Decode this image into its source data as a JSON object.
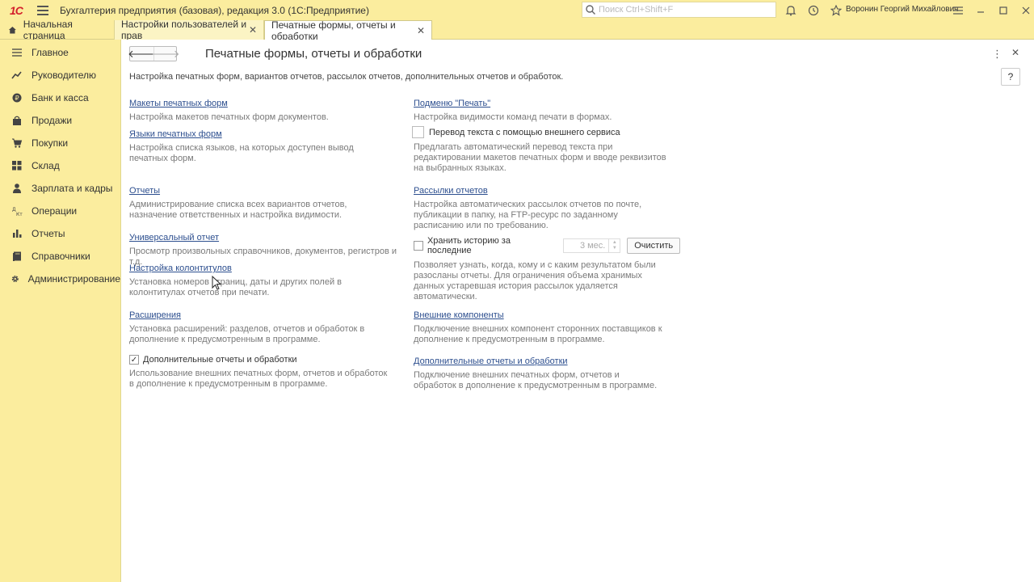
{
  "app": {
    "logo": "1С",
    "title": "Бухгалтерия предприятия (базовая), редакция 3.0  (1С:Предприятие)",
    "search_placeholder": "Поиск Ctrl+Shift+F",
    "user": "Воронин Георгий Михайлович"
  },
  "tabs": [
    {
      "label": "Начальная страница"
    },
    {
      "label": "Настройки пользователей и прав"
    },
    {
      "label": "Печатные формы, отчеты и обработки"
    }
  ],
  "sidebar": {
    "items": [
      {
        "label": "Главное",
        "icon": "menu-icon"
      },
      {
        "label": "Руководителю",
        "icon": "trend-icon"
      },
      {
        "label": "Банк и касса",
        "icon": "coin-icon"
      },
      {
        "label": "Продажи",
        "icon": "bag-icon"
      },
      {
        "label": "Покупки",
        "icon": "cart-icon"
      },
      {
        "label": "Склад",
        "icon": "warehouse-icon"
      },
      {
        "label": "Зарплата и кадры",
        "icon": "person-icon"
      },
      {
        "label": "Операции",
        "icon": "operations-icon"
      },
      {
        "label": "Отчеты",
        "icon": "chart-icon"
      },
      {
        "label": "Справочники",
        "icon": "book-icon"
      },
      {
        "label": "Администрирование",
        "icon": "gear-icon"
      }
    ]
  },
  "page": {
    "title": "Печатные формы, отчеты и обработки",
    "help": "?",
    "subtitle": "Настройка печатных форм, вариантов отчетов, рассылок отчетов, дополнительных отчетов и обработок."
  },
  "left": {
    "layouts": {
      "link": "Макеты печатных форм",
      "desc": "Настройка макетов печатных форм документов."
    },
    "languages": {
      "link": "Языки печатных форм",
      "desc": "Настройка списка языков, на которых доступен вывод печатных форм."
    },
    "reports": {
      "link": "Отчеты",
      "desc": "Администрирование списка всех вариантов отчетов, назначение ответственных и настройка видимости."
    },
    "universal": {
      "link": "Универсальный отчет",
      "desc": "Просмотр произвольных справочников, документов, регистров и т.д."
    },
    "headers": {
      "link": "Настройка колонтитулов",
      "desc": "Установка номеров страниц, даты и других полей в колонтитулах отчетов при печати."
    },
    "extensions": {
      "link": "Расширения",
      "desc": "Установка расширений: разделов, отчетов и обработок в дополнение к предусмотренным в программе."
    },
    "additional": {
      "label": "Дополнительные отчеты и обработки",
      "checked": true,
      "desc": "Использование внешних печатных форм, отчетов и обработок в дополнение к предусмотренным в программе."
    }
  },
  "right": {
    "print_menu": {
      "link": "Подменю \"Печать\"",
      "desc": "Настройка видимости команд печати в формах."
    },
    "translate": {
      "label": "Перевод текста с помощью внешнего сервиса",
      "checked": false,
      "desc": "Предлагать автоматический перевод текста при редактировании макетов печатных форм и вводе реквизитов на выбранных языках."
    },
    "mailing": {
      "link": "Рассылки отчетов",
      "desc": "Настройка автоматических рассылок отчетов по почте, публикации в папку, на FTP-ресурс по заданному расписанию или по требованию."
    },
    "history": {
      "label": "Хранить историю за последние",
      "checked": false,
      "value": "3 мес.",
      "clear": "Очистить",
      "desc": "Позволяет узнать, когда, кому и с каким результатом были разосланы отчеты. Для ограничения объема хранимых данных устаревшая история рассылок удаляется автоматически."
    },
    "external": {
      "link": "Внешние компоненты",
      "desc": "Подключение внешних компонент сторонних поставщиков к дополнение к предусмотренным в программе."
    },
    "additional": {
      "link": "Дополнительные отчеты и обработки",
      "desc": "Подключение внешних печатных форм, отчетов и обработок в дополнение к предусмотренным в программе."
    }
  }
}
